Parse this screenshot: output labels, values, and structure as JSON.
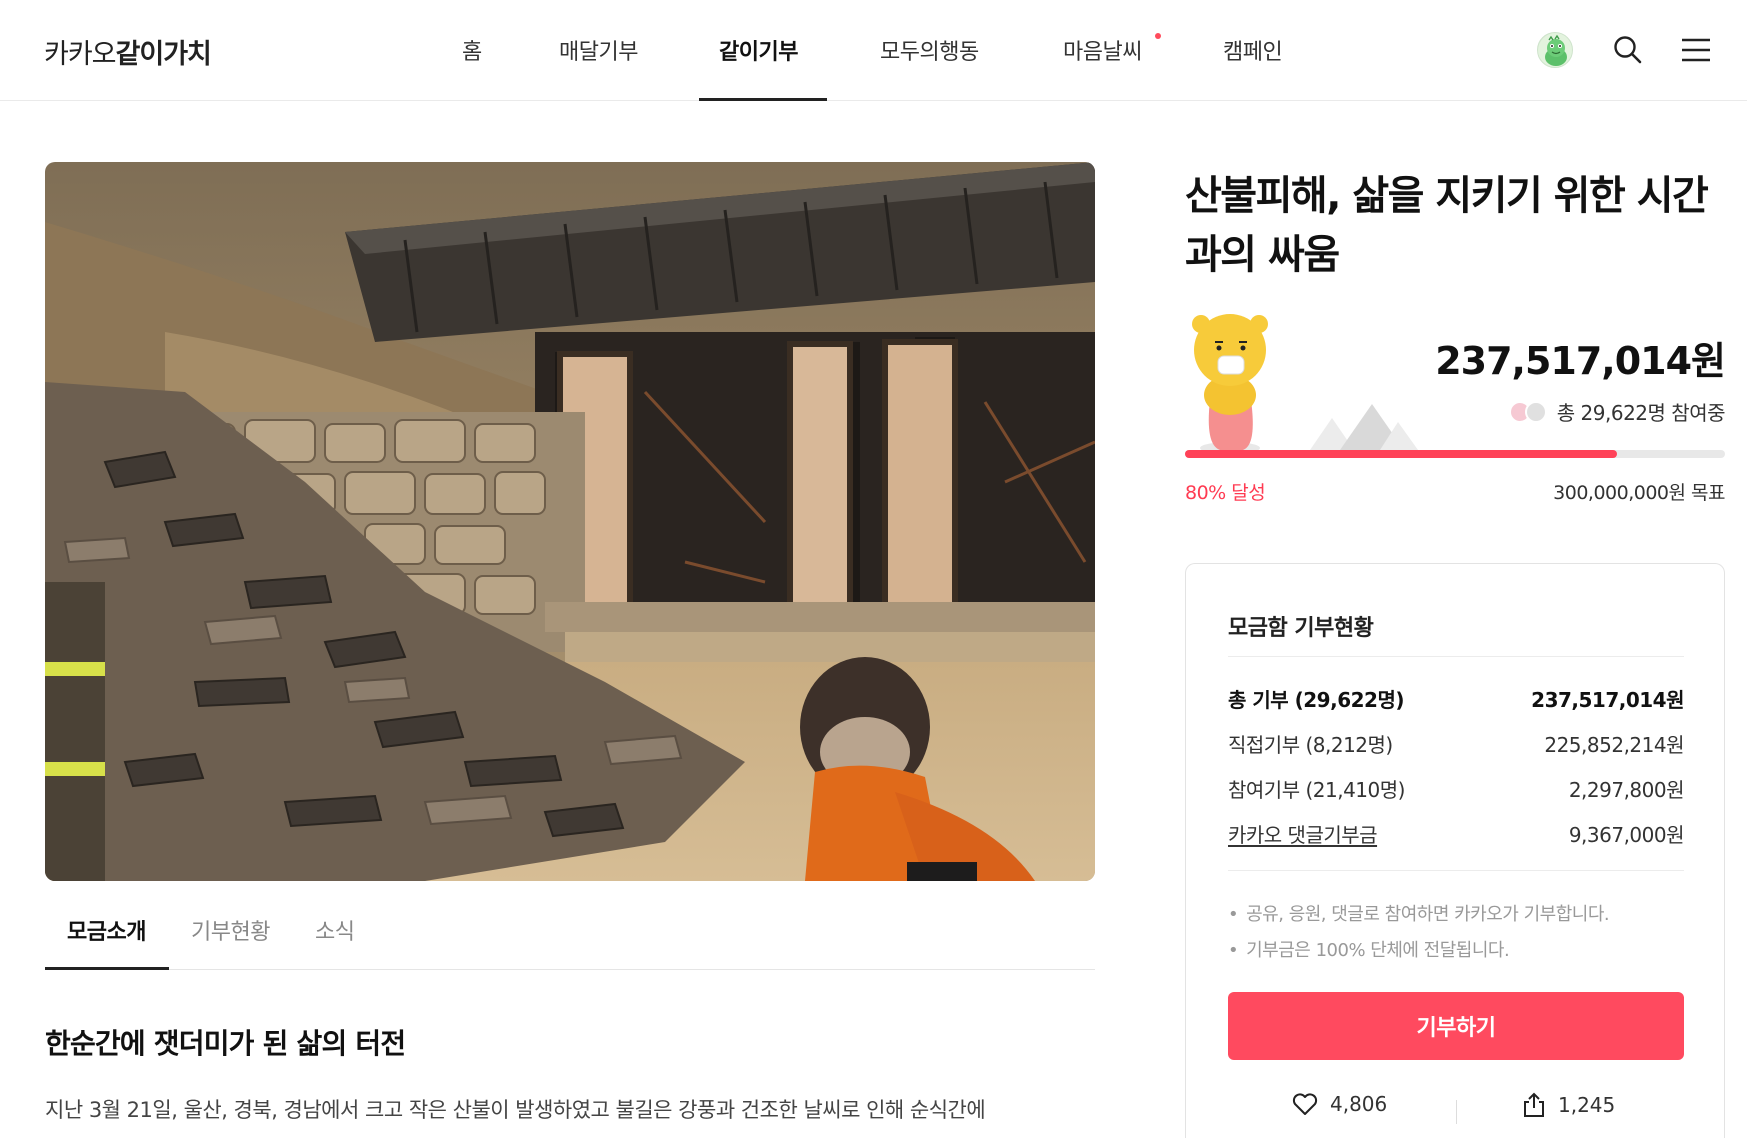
{
  "header": {
    "logo_prefix": "카카오",
    "logo_main": "같이가치",
    "nav": [
      {
        "label": "홈"
      },
      {
        "label": "매달기부"
      },
      {
        "label": "같이기부"
      },
      {
        "label": "모두의행동"
      },
      {
        "label": "마음날씨"
      },
      {
        "label": "캠페인"
      }
    ],
    "active_nav": "같이기부"
  },
  "tabs": [
    {
      "label": "모금소개"
    },
    {
      "label": "기부현황"
    },
    {
      "label": "소식"
    }
  ],
  "article": {
    "heading": "한순간에 잿더미가 된 삶의 터전",
    "body": "지난 3월 21일, 울산, 경북, 경남에서 크고 작은 산불이 발생하였고 불길은 강풍과 건조한 날씨로 인해 순식간에"
  },
  "campaign": {
    "title": "산불피해, 삶을 지키기 위한 시간과의 싸움",
    "amount": "237,517,014원",
    "participants": "총 29,622명 참여중",
    "progress_percent": 80,
    "achievement": "80% 달성",
    "goal": "300,000,000원 목표"
  },
  "donation_box": {
    "title": "모금함 기부현황",
    "rows": [
      {
        "label": "총 기부 (29,622명)",
        "value": "237,517,014원"
      },
      {
        "label": "직접기부 (8,212명)",
        "value": "225,852,214원"
      },
      {
        "label": "참여기부 (21,410명)",
        "value": "2,297,800원"
      },
      {
        "label": "카카오 댓글기부금",
        "value": "9,367,000원"
      }
    ],
    "notes": [
      "공유, 응원, 댓글로 참여하면 카카오가 기부합니다.",
      "기부금은 100% 단체에 전달됩니다."
    ],
    "donate_label": "기부하기",
    "likes": "4,806",
    "shares": "1,245"
  },
  "colors": {
    "accent": "#ff4a5f",
    "progress": "#ff4258",
    "achieve_text": "#ff3b52"
  }
}
